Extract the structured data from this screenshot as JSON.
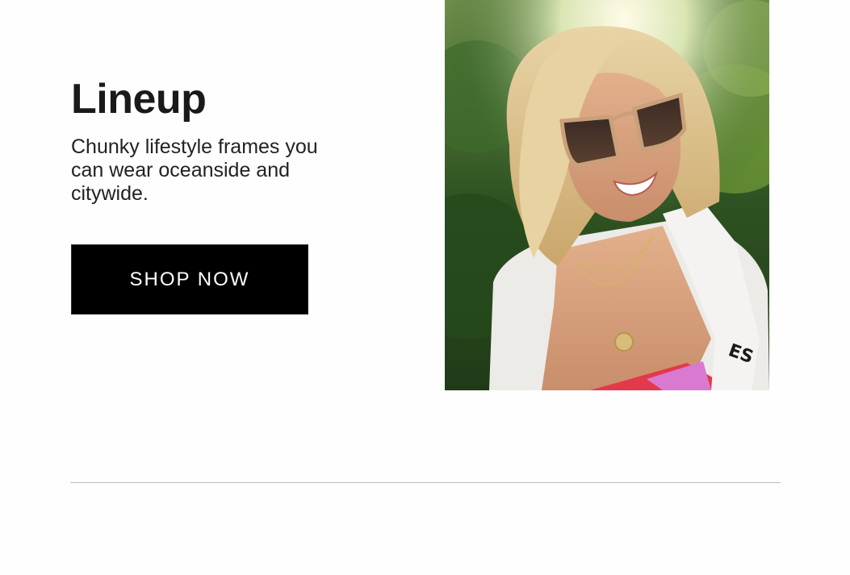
{
  "promo": {
    "title": "Lineup",
    "description": "Chunky lifestyle frames you can wear oceanside and citywide.",
    "cta_label": "SHOP NOW"
  },
  "colors": {
    "page_background": "#fefefe",
    "button_background": "#000000",
    "button_text": "#ffffff",
    "divider": "#bdbdbd"
  }
}
